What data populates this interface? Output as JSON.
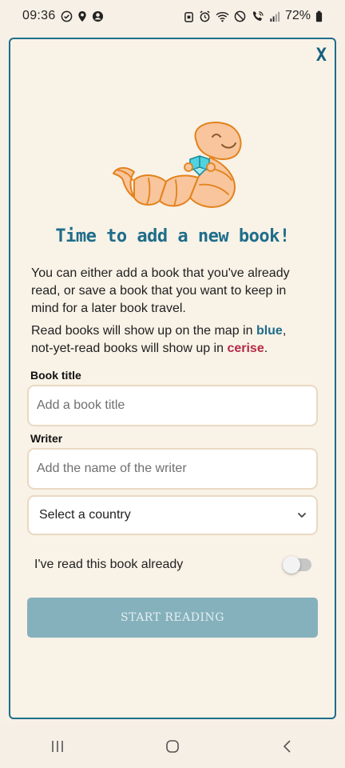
{
  "status_bar": {
    "time": "09:36",
    "battery": "72%",
    "icons_left": [
      "check-circle-icon",
      "location-icon",
      "account-icon"
    ],
    "icons_right": [
      "alarm-icon",
      "wifi-icon",
      "do-not-disturb-icon",
      "wifi-call-icon",
      "signal-icon",
      "battery-icon"
    ]
  },
  "dialog": {
    "close_label": "X",
    "heading": "Time to add a new book!",
    "intro": "You can either add a book that you've already read, or save a book that you want to keep in mind for a later book travel.",
    "legend_prefix": "Read books will show up on the map in ",
    "legend_blue": "blue",
    "legend_middle": ", not-yet-read books will show up in ",
    "legend_cerise": "cerise",
    "legend_suffix": ".",
    "book_title_label": "Book title",
    "book_title_placeholder": "Add a book title",
    "book_title_value": "",
    "writer_label": "Writer",
    "writer_placeholder": "Add the name of the writer",
    "writer_value": "",
    "country_select": "Select a country",
    "read_toggle_label": "I've read this book already",
    "read_toggle_on": false,
    "start_button": "START READING"
  },
  "colors": {
    "accent": "#1e6d8a",
    "cerise": "#b42a45",
    "button_disabled": "#85b1bc",
    "background": "#f7f0e6"
  }
}
